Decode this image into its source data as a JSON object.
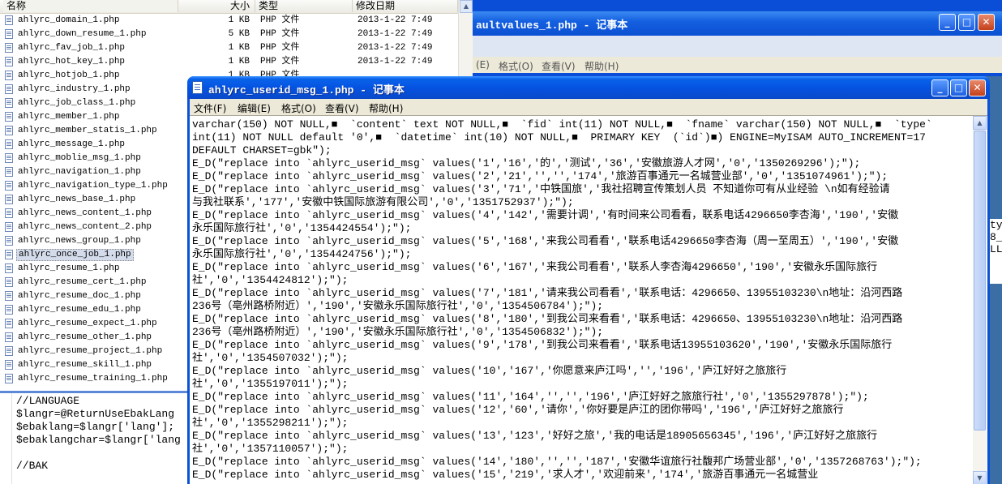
{
  "explorer": {
    "columns": {
      "name": "名称",
      "size": "大小",
      "type": "类型",
      "date": "修改日期"
    },
    "files": [
      {
        "name": "ahlyrc_domain_1.php",
        "size": "1 KB",
        "type": "PHP 文件",
        "date": "2013-1-22 7:49"
      },
      {
        "name": "ahlyrc_down_resume_1.php",
        "size": "5 KB",
        "type": "PHP 文件",
        "date": "2013-1-22 7:49"
      },
      {
        "name": "ahlyrc_fav_job_1.php",
        "size": "1 KB",
        "type": "PHP 文件",
        "date": "2013-1-22 7:49"
      },
      {
        "name": "ahlyrc_hot_key_1.php",
        "size": "1 KB",
        "type": "PHP 文件",
        "date": "2013-1-22 7:49"
      },
      {
        "name": "ahlyrc_hotjob_1.php",
        "size": "1 KB",
        "type": "PHP 文件",
        "date": ""
      },
      {
        "name": "ahlyrc_industry_1.php",
        "size": "",
        "type": "",
        "date": ""
      },
      {
        "name": "ahlyrc_job_class_1.php",
        "size": "",
        "type": "",
        "date": ""
      },
      {
        "name": "ahlyrc_member_1.php",
        "size": "",
        "type": "",
        "date": ""
      },
      {
        "name": "ahlyrc_member_statis_1.php",
        "size": "",
        "type": "",
        "date": ""
      },
      {
        "name": "ahlyrc_message_1.php",
        "size": "",
        "type": "",
        "date": ""
      },
      {
        "name": "ahlyrc_moblie_msg_1.php",
        "size": "",
        "type": "",
        "date": ""
      },
      {
        "name": "ahlyrc_navigation_1.php",
        "size": "",
        "type": "",
        "date": ""
      },
      {
        "name": "ahlyrc_navigation_type_1.php",
        "size": "",
        "type": "",
        "date": ""
      },
      {
        "name": "ahlyrc_news_base_1.php",
        "size": "",
        "type": "",
        "date": ""
      },
      {
        "name": "ahlyrc_news_content_1.php",
        "size": "",
        "type": "",
        "date": ""
      },
      {
        "name": "ahlyrc_news_content_2.php",
        "size": "",
        "type": "",
        "date": ""
      },
      {
        "name": "ahlyrc_news_group_1.php",
        "size": "",
        "type": "",
        "date": ""
      },
      {
        "name": "ahlyrc_once_job_1.php",
        "size": "",
        "type": "",
        "date": "",
        "selected": true
      },
      {
        "name": "ahlyrc_resume_1.php",
        "size": "",
        "type": "",
        "date": ""
      },
      {
        "name": "ahlyrc_resume_cert_1.php",
        "size": "",
        "type": "",
        "date": ""
      },
      {
        "name": "ahlyrc_resume_doc_1.php",
        "size": "",
        "type": "",
        "date": ""
      },
      {
        "name": "ahlyrc_resume_edu_1.php",
        "size": "",
        "type": "",
        "date": ""
      },
      {
        "name": "ahlyrc_resume_expect_1.php",
        "size": "",
        "type": "",
        "date": ""
      },
      {
        "name": "ahlyrc_resume_other_1.php",
        "size": "",
        "type": "",
        "date": ""
      },
      {
        "name": "ahlyrc_resume_project_1.php",
        "size": "",
        "type": "",
        "date": ""
      },
      {
        "name": "ahlyrc_resume_skill_1.php",
        "size": "",
        "type": "",
        "date": ""
      },
      {
        "name": "ahlyrc_resume_training_1.php",
        "size": "",
        "type": "",
        "date": ""
      }
    ]
  },
  "bg_notepad": {
    "title": "aultvalues_1.php - 记事本",
    "menu": [
      "(E)",
      "格式(O)",
      "查看(V)",
      "帮助(H)"
    ]
  },
  "code_panel": {
    "lines": [
      "//LANGUAGE",
      "$langr=@ReturnUseEbakLang",
      "$ebaklang=$langr['lang'];",
      "$ebaklangchar=$langr['lang",
      "",
      "//BAK"
    ]
  },
  "right_strip": [
    "typ",
    "8_",
    "LL"
  ],
  "notepad": {
    "title": "ahlyrc_userid_msg_1.php - 记事本",
    "menu": [
      "文件(F)",
      "编辑(E)",
      "格式(O)",
      "查看(V)",
      "帮助(H)"
    ],
    "lines": [
      "varchar(150) NOT NULL,■  `content` text NOT NULL,■  `fid` int(11) NOT NULL,■  `fname` varchar(150) NOT NULL,■  `type`",
      "int(11) NOT NULL default '0',■  `datetime` int(10) NOT NULL,■  PRIMARY KEY  (`id`)■) ENGINE=MyISAM AUTO_INCREMENT=17",
      "DEFAULT CHARSET=gbk\");",
      "E_D(\"replace into `ahlyrc_userid_msg` values('1','16','的','测试','36','安徽旅游人才网','0','1350269296');\");",
      "E_D(\"replace into `ahlyrc_userid_msg` values('2','21','','','174','旅游百事通元一名城营业部','0','1351074961');\");",
      "E_D(\"replace into `ahlyrc_userid_msg` values('3','71','中铁国旅','我社招聘宣传策划人员 不知道你可有从业经验 \\n如有经验请",
      "与我社联系','177','安徽中铁国际旅游有限公司','0','1351752937');\");",
      "E_D(\"replace into `ahlyrc_userid_msg` values('4','142','需要计调','有时间来公司看看，联系电话4296650李杏海','190','安徽",
      "永乐国际旅行社','0','1354424554');\");",
      "E_D(\"replace into `ahlyrc_userid_msg` values('5','168','来我公司看看','联系电话4296650李杏海（周一至周五）','190','安徽",
      "永乐国际旅行社','0','1354424756');\");",
      "E_D(\"replace into `ahlyrc_userid_msg` values('6','167','来我公司看看','联系人李杏海4296650','190','安徽永乐国际旅行",
      "社','0','1354424812');\");",
      "E_D(\"replace into `ahlyrc_userid_msg` values('7','181','请来我公司看看','联系电话：4296650、13955103230\\n地址：沿河西路",
      "236号（亳州路桥附近）','190','安徽永乐国际旅行社','0','1354506784');\");",
      "E_D(\"replace into `ahlyrc_userid_msg` values('8','180','到我公司来看看','联系电话：4296650、13955103230\\n地址：沿河西路",
      "236号（亳州路桥附近）','190','安徽永乐国际旅行社','0','1354506832');\");",
      "E_D(\"replace into `ahlyrc_userid_msg` values('9','178','到我公司来看看','联系电话13955103620','190','安徽永乐国际旅行",
      "社','0','1354507032');\");",
      "E_D(\"replace into `ahlyrc_userid_msg` values('10','167','你愿意来庐江吗','','196','庐江好好之旅旅行",
      "社','0','1355197011');\");",
      "E_D(\"replace into `ahlyrc_userid_msg` values('11','164','','','196','庐江好好之旅旅行社','0','1355297878');\");",
      "E_D(\"replace into `ahlyrc_userid_msg` values('12','60','请你','你好要是庐江的团你带吗','196','庐江好好之旅旅行",
      "社','0','1355298211');\");",
      "E_D(\"replace into `ahlyrc_userid_msg` values('13','123','好好之旅','我的电话是18905656345','196','庐江好好之旅旅行",
      "社','0','1357110057');\");",
      "E_D(\"replace into `ahlyrc_userid_msg` values('14','180','','','187','安徽华谊旅行社馥邦广场营业部','0','1357268763');\");",
      "E_D(\"replace into `ahlyrc_userid_msg` values('15','219','求人才','欢迎前来','174','旅游百事通元一名城营业"
    ]
  }
}
